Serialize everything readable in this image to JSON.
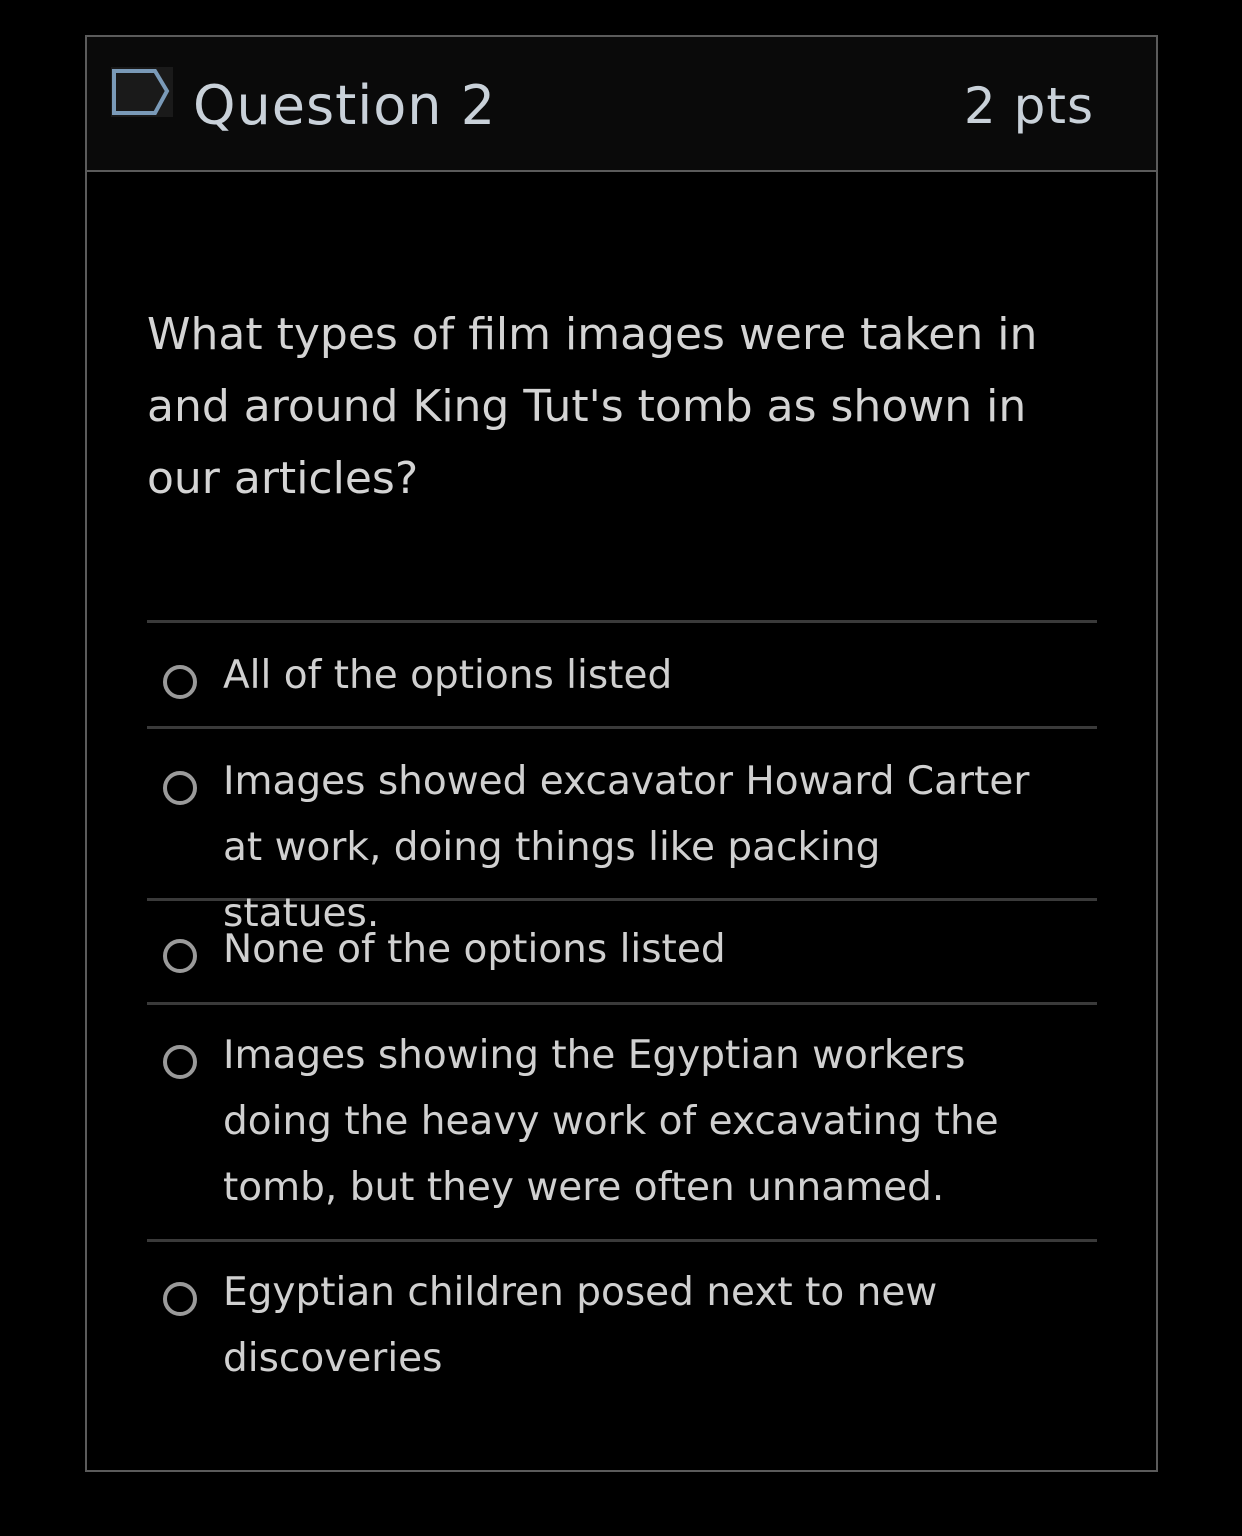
{
  "question": {
    "title": "Question 2",
    "points": "2 pts",
    "text": "What types of film images were taken in and around King Tut's tomb as shown in our articles?",
    "flag_icon": "flag-outline-icon"
  },
  "answers": [
    {
      "label": "All of the options listed",
      "selected": false
    },
    {
      "label": "Images showed excavator Howard Carter at work, doing things like packing statues.",
      "selected": false
    },
    {
      "label": "None of the options listed",
      "selected": false
    },
    {
      "label": "Images showing the Egyptian workers doing the heavy work of excavating the tomb, but they were often unnamed.",
      "selected": false
    },
    {
      "label": "Egyptian children posed next to new discoveries",
      "selected": false
    }
  ],
  "colors": {
    "background": "#000000",
    "header_background": "#0a0a0a",
    "border": "#5b5b5b",
    "text": "#d4d4d4",
    "flag_accent": "#7a9ab8"
  }
}
